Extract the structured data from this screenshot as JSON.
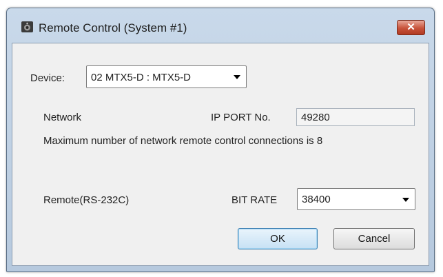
{
  "window": {
    "title": "Remote Control (System #1)",
    "close_label": "✕",
    "icon": "speaker-app-icon"
  },
  "device": {
    "label": "Device:",
    "selected": "02 MTX5-D : MTX5-D"
  },
  "network": {
    "label": "Network",
    "ip_port_label": "IP PORT No.",
    "ip_port_value": "49280",
    "note": "Maximum number of network remote control connections is 8"
  },
  "remote": {
    "label": "Remote(RS-232C)",
    "bit_rate_label": "BIT RATE",
    "bit_rate_selected": "38400"
  },
  "buttons": {
    "ok": "OK",
    "cancel": "Cancel"
  },
  "colors": {
    "title_bar": "#b6c9de",
    "close_button": "#c8523a",
    "dialog_bg": "#f0f0f0",
    "ok_border": "#3c7fb1"
  }
}
